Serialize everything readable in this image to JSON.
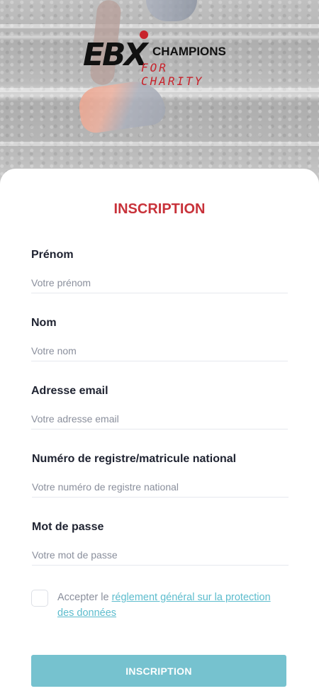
{
  "brand": {
    "logo_primary": "EBX",
    "logo_secondary": "CHAMPIONS",
    "logo_tagline": "FOR CHARITY",
    "accent_color": "#c8232c"
  },
  "form": {
    "title": "INSCRIPTION",
    "fields": [
      {
        "label": "Prénom",
        "placeholder": "Votre prénom"
      },
      {
        "label": "Nom",
        "placeholder": "Votre nom"
      },
      {
        "label": "Adresse email",
        "placeholder": "Votre adresse email"
      },
      {
        "label": "Numéro de registre/matricule national",
        "placeholder": "Votre numéro de registre national"
      },
      {
        "label": "Mot de passe",
        "placeholder": "Votre mot de passe"
      }
    ],
    "consent": {
      "prefix": "Accepter le ",
      "link_text": "réglement général sur la protection des données",
      "checked": false
    },
    "submit_label": "INSCRIPTION",
    "button_color": "#76c2cf"
  }
}
